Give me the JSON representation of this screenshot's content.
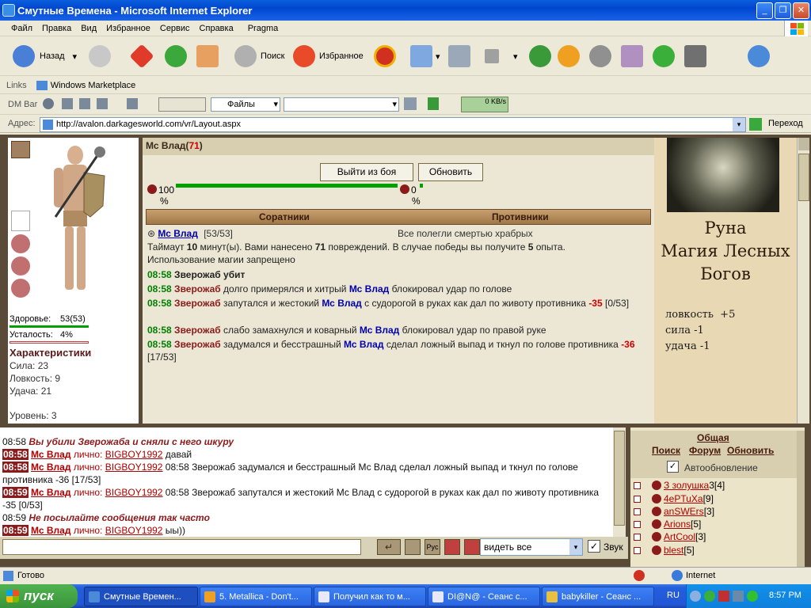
{
  "window": {
    "title": "Смутные Времена - Microsoft Internet Explorer"
  },
  "menu": [
    "Файл",
    "Правка",
    "Вид",
    "Избранное",
    "Сервис",
    "Справка",
    "Pragma"
  ],
  "toolbar": {
    "back": "Назад",
    "search": "Поиск",
    "favorites": "Избранное"
  },
  "links": {
    "label": "Links",
    "item": "Windows Marketplace"
  },
  "dmbar": {
    "label": "DM Bar",
    "files": "Файлы",
    "speed": "0 KB/s"
  },
  "address": {
    "label": "Адрес:",
    "url": "http://avalon.darkagesworld.com/vr/Layout.aspx",
    "go": "Переход"
  },
  "character": {
    "health_label": "Здоровье:",
    "health_value": "53(53)",
    "fatigue_label": "Усталость:",
    "fatigue_value": "4%",
    "stats_title": "Характеристики",
    "strength": "Сила: 23",
    "agility": "Ловкость: 9",
    "luck": "Удача: 21",
    "level": "Уровень: 3"
  },
  "battle": {
    "player": "Мс Влад",
    "player_level": "71",
    "leave_button": "Выйти из боя",
    "refresh_button": "Обновить",
    "own_value": "100",
    "own_unit": "%",
    "enemy_value": "0",
    "enemy_unit": "%",
    "own_bar_fraction": 1.0,
    "enemy_bar_fraction": 0.0,
    "col_allies": "Соратники",
    "col_enemies": "Противники",
    "ally_name": "Мс Влад",
    "ally_hp": "[53/53]",
    "enemies_status": "Все полегли смертью храбрых",
    "timeout_a": "Таймаут ",
    "timeout_num": "10",
    "timeout_b": " минут(ы). Вами нанесено ",
    "damage": "71",
    "timeout_c": " повреждений. В случае победы вы получите ",
    "exp": "5",
    "timeout_d": " опыта.",
    "magic_forbidden": "Использование магии запрещено",
    "log": [
      {
        "time": "08:58",
        "text": "Зверожаб убит"
      },
      {
        "time": "08:58",
        "a": "Зверожаб",
        "b": " долго примерялся и хитрый ",
        "c": "Мс Влад",
        "d": " блокировал удар по голове"
      },
      {
        "time": "08:58",
        "a": "Зверожаб",
        "b": " запутался и жестокий ",
        "c": "Мс Влад",
        "d": " с судорогой в руках как дал по животу противника ",
        "dmg": "-35",
        "e": "[0/53]"
      },
      {
        "time": "08:58",
        "a": "Зверожаб",
        "b": " слабо замахнулся и коварный ",
        "c": "Мс Влад",
        "d": " блокировал удар по правой руке"
      },
      {
        "time": "08:58",
        "a": "Зверожаб",
        "b": " задумался и бесстрашный ",
        "c": "Мс Влад",
        "d": " сделал ложный выпад и ткнул по голове противника ",
        "dmg": "-36",
        "e": "[17/53]"
      }
    ]
  },
  "rune": {
    "title1": "Руна",
    "title2": "Магия Лесных",
    "title3": "Богов",
    "b1": "ловкость  +5",
    "b2": "сила -1",
    "b3": "удача -1"
  },
  "chat": {
    "l1_time": "08:58",
    "l1_text": "Вы убили Зверожаба и сняли с него шкуру",
    "lines": [
      {
        "time": "08:58",
        "nick": "Мс Влад",
        "mid": " лично: ",
        "to": "BIGBOY1992",
        "msg": " давай"
      },
      {
        "time": "08:58",
        "nick": "Мс Влад",
        "mid": " лично: ",
        "to": "BIGBOY1992",
        "msg": " 08:58 Зверожаб задумался и бесстрашный Мс Влад сделал ложный выпад и ткнул по голове противника -36 [17/53]"
      },
      {
        "time": "08:59",
        "nick": "Мс Влад",
        "mid": " лично: ",
        "to": "BIGBOY1992",
        "msg": " 08:58 Зверожаб запутался и жестокий Мс Влад с судорогой в руках как дал по животу противника -35 [0/53]"
      }
    ],
    "l5_time": "08:59",
    "l5_text": "Не посылайте сообщения так часто",
    "l6": {
      "time": "08:59",
      "nick": "Мс Влад",
      "mid": " лично: ",
      "to": "BIGBOY1992",
      "msg": " ыы))"
    },
    "filter": "видеть все",
    "sound": "Звук"
  },
  "players": {
    "tab_common": "Общая",
    "search": "Поиск",
    "forum": "Форум",
    "refresh": "Обновить",
    "auto": "Автообновление",
    "list": [
      {
        "name": "З золушка",
        "level": "3[4]"
      },
      {
        "name": "4ePTuXa",
        "level": "[9]"
      },
      {
        "name": "anSWErs",
        "level": "[3]"
      },
      {
        "name": "Arions",
        "level": "[5]"
      },
      {
        "name": "ArtCool",
        "level": "[3]"
      },
      {
        "name": "blest",
        "level": "[5]"
      }
    ]
  },
  "status": {
    "ready": "Готово",
    "zone": "Internet"
  },
  "taskbar": {
    "start": "пуск",
    "tasks": [
      "Смутные Времен...",
      "5. Metallica - Don't...",
      "Получил как то м...",
      "DI@N@ - Сеанс с...",
      "babykiller - Сеанс ..."
    ],
    "lang": "RU",
    "clock": "8:57 PM"
  }
}
